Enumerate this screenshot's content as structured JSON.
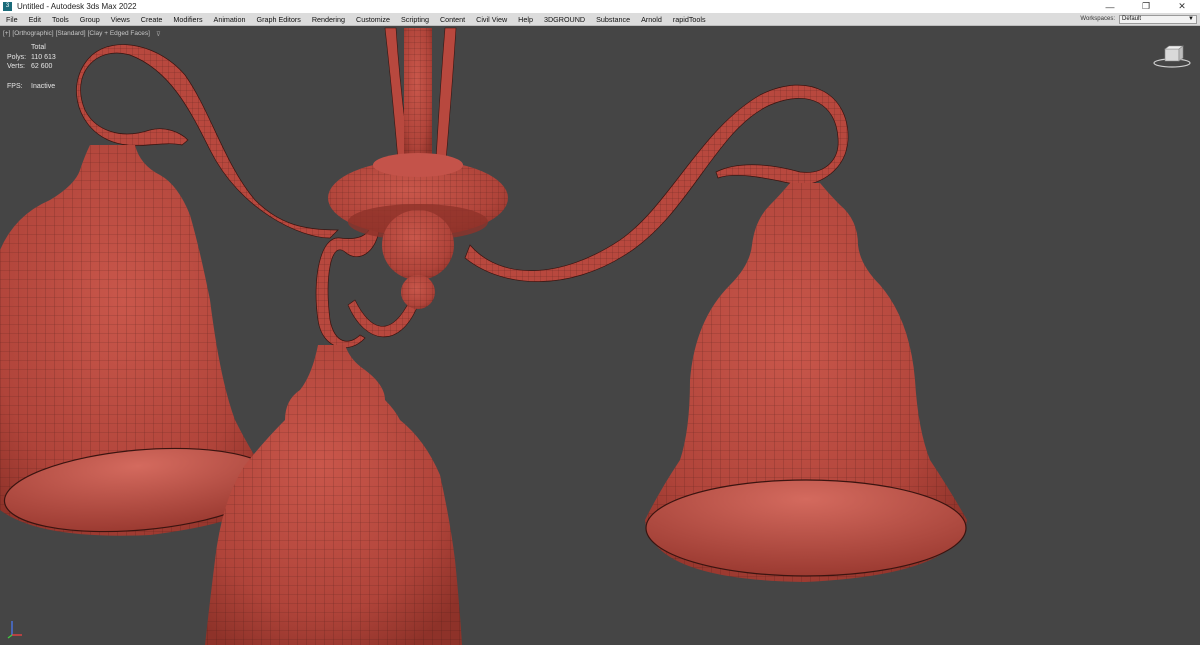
{
  "window": {
    "title": "Untitled - Autodesk 3ds Max 2022",
    "app_icon_glyph": "3",
    "buttons": {
      "minimize": "—",
      "restore": "❐",
      "close": "✕"
    }
  },
  "menubar": {
    "items": [
      "File",
      "Edit",
      "Tools",
      "Group",
      "Views",
      "Create",
      "Modifiers",
      "Animation",
      "Graph Editors",
      "Rendering",
      "Customize",
      "Scripting",
      "Content",
      "Civil View",
      "Help",
      "3DGROUND",
      "Substance",
      "Arnold",
      "rapidTools"
    ],
    "workspaces_label": "Workspaces:",
    "workspaces_value": "Default",
    "workspaces_arrow": "▼"
  },
  "viewport": {
    "label_plus": "[+]",
    "label_view": "[Orthographic]",
    "label_shading": "[Standard]",
    "label_mode": "[Clay + Edged Faces]",
    "filter_icon": "⊽",
    "stats": {
      "header": "Total",
      "polys_label": "Polys:",
      "polys_value": "110 613",
      "verts_label": "Verts:",
      "verts_value": "62 600",
      "fps_label": "FPS:",
      "fps_value": "Inactive"
    },
    "model_color": "#b8483e",
    "wire_color": "#3a1410",
    "background_color": "#454545"
  }
}
